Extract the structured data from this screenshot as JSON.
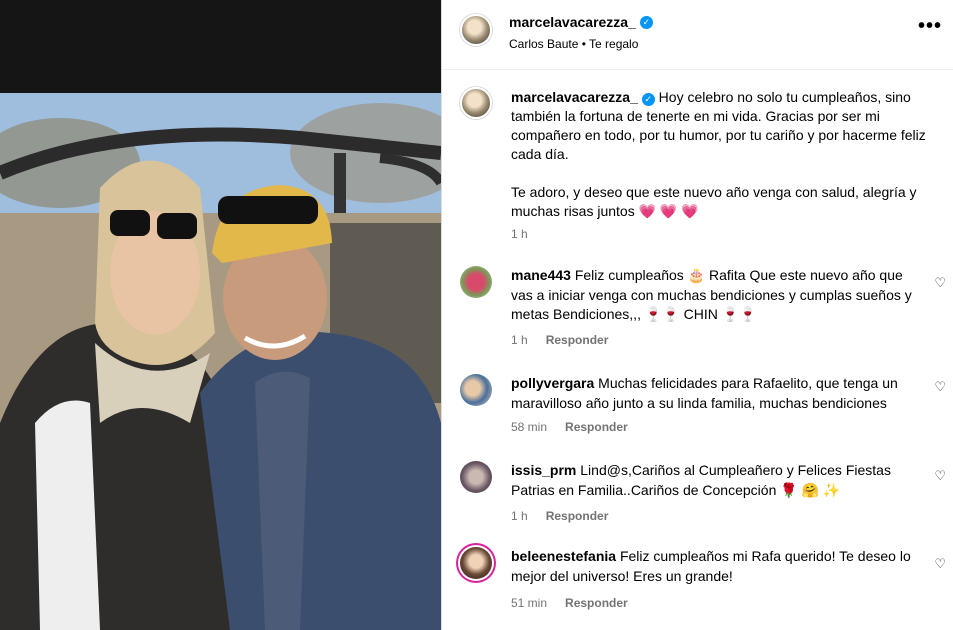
{
  "post": {
    "author": "marcelavacarezza_",
    "audio": "Carlos Baute • Te regalo",
    "caption_p1": "Hoy celebro no solo tu cumpleaños, sino también la fortuna de tenerte en mi vida. Gracias por ser mi compañero en todo, por tu humor, por tu cariño y por hacerme feliz cada día.",
    "caption_p2": "Te adoro, y deseo que este nuevo año venga con salud, alegría y muchas risas juntos",
    "caption_emoji": "💗 💗 💗",
    "caption_time": "1 h",
    "more_icon": "•••"
  },
  "reply_label": "Responder",
  "comments": [
    {
      "user": "mane443",
      "text": "Feliz cumpleaños 🎂 Rafita Que este nuevo año que vas a iniciar venga con muchas bendiciones y cumplas sueños y metas Bendiciones,,, 🍷🍷 CHIN 🍷🍷",
      "time": "1 h"
    },
    {
      "user": "pollyvergara",
      "text": "Muchas felicidades para Rafaelito, que tenga un maravilloso año junto a su linda familia, muchas bendiciones",
      "time": "58 min"
    },
    {
      "user": "issis_prm",
      "text": "Lind@s,Cariños al Cumpleañero y Felices Fiestas Patrias en Familia..Cariños de Concepción 🌹 🤗 ✨",
      "time": "1 h"
    },
    {
      "user": "beleenestefania",
      "text": "Feliz cumpleaños mi Rafa querido! Te deseo lo mejor del universo! Eres un grande!",
      "time": "51 min"
    }
  ],
  "colors": {
    "verified": "#0095f6",
    "muted": "#737373",
    "divider": "#efefef"
  }
}
